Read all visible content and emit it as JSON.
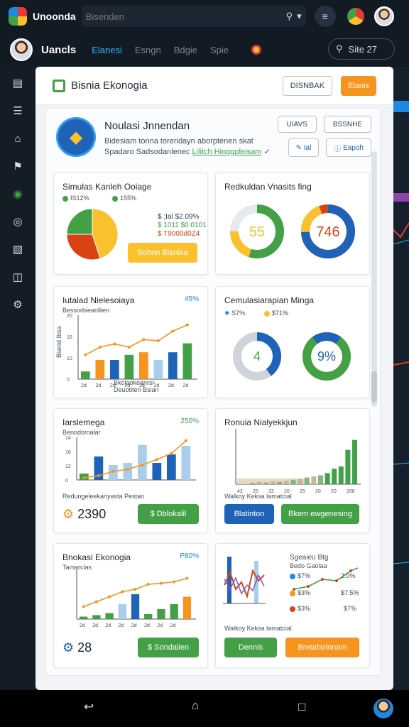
{
  "topbar": {
    "app_title": "Unoonda",
    "search_placeholder": "Bisenden"
  },
  "navbar": {
    "title": "Uancls",
    "tabs": [
      "Elanesi",
      "Esngn",
      "Bdgie",
      "Spie"
    ],
    "active_tab": 0,
    "site_search": "Site 27"
  },
  "window": {
    "title": "Bisnia Ekonogia",
    "btn_outline": "DISNBAK",
    "btn_primary": "Elanis"
  },
  "profile": {
    "title": "Noulasi Jnnendan",
    "line1": "Bidesiam tonna toreridayn aborptenen skat",
    "line2_text": "Spadaro Sadsodanlenec",
    "line2_link": "Lilitch Hinggpleisam",
    "btn_a": "UIAVS",
    "btn_b": "BSSNHE",
    "btn_c": "Ial",
    "btn_d": "Eapoh"
  },
  "cards": {
    "c1": {
      "title": "Simulas Kanleh Ooiage",
      "legend_a": "IS12%",
      "legend_b": "155%",
      "values": [
        "$ ;Ial $2.09%",
        "$ 1011 $0.0101",
        "$ T9000d0Z4"
      ],
      "button": "Sohon Blanisa",
      "pie": [
        45,
        30,
        25
      ]
    },
    "c2": {
      "title": "Redkuldan Vnasits fing",
      "donut_a_label": "55",
      "donut_a_value": 55,
      "donut_b_label": "746",
      "donut_b_value": 74.6
    },
    "c3": {
      "title": "Iutalad Nielesoiaya",
      "corner": "45%",
      "ylabel": "Bianid Ibsa",
      "note1": "Bessorbieanllien",
      "xlabel": "Bkolaokeanrsr",
      "xlabel2": "Deuotiten Bsian",
      "ticks": [
        "20",
        "16",
        "10",
        "0"
      ],
      "xticks": [
        "2d",
        "2d",
        "2d",
        "2d",
        "2d",
        "2d",
        "2d",
        "2d"
      ]
    },
    "c4": {
      "title": "Cemulasiarapian Minga",
      "legend_a": "S7%",
      "legend_b": "$71%",
      "donut_a_label": "4",
      "donut_a_value": 40,
      "donut_b_label": "9%",
      "donut_b_value": 90
    },
    "c5": {
      "title": "Iarslemega",
      "corner": "250%",
      "sub": "Benodomalar",
      "caption": "Redungeleekanyasta Pestan",
      "value": "2390",
      "button": "Dblokalil",
      "ticks": [
        "14",
        "16",
        "12",
        "0"
      ]
    },
    "c6": {
      "title": "Ronuia Nialyekkjun",
      "caption": "Walkoy Keksa lamatcial",
      "btn_a": "Blatinton",
      "btn_b": "Bkem ewgenesing",
      "xticks": [
        "42",
        "25",
        "22",
        "20",
        "25",
        "20",
        "20",
        "208"
      ]
    },
    "c7": {
      "title": "Bnokasi Ekonogia",
      "corner": "P80%",
      "sub": "Tamarclas",
      "value": "28",
      "button": "Sondalien",
      "xticks": [
        "2d",
        "2d",
        "2d",
        "2d",
        "2d",
        "2d",
        "2d",
        "2d"
      ]
    },
    "c8": {
      "title": "Sgeaieu Btg",
      "caption": "Walkoy Keksa lamatcial",
      "legend": [
        "$7%",
        "$3%",
        "$3%"
      ],
      "right_vals": [
        "2.0%",
        "$7.5%",
        "$7%"
      ],
      "sub": "Bedo Gaolaa",
      "btn_a": "Dennis",
      "btn_b": "Bretafarinnam"
    }
  },
  "colors": {
    "green": "#43a047",
    "orange": "#f7941d",
    "blue": "#1e63b8",
    "yellow": "#fbc02d",
    "red": "#d84315"
  }
}
